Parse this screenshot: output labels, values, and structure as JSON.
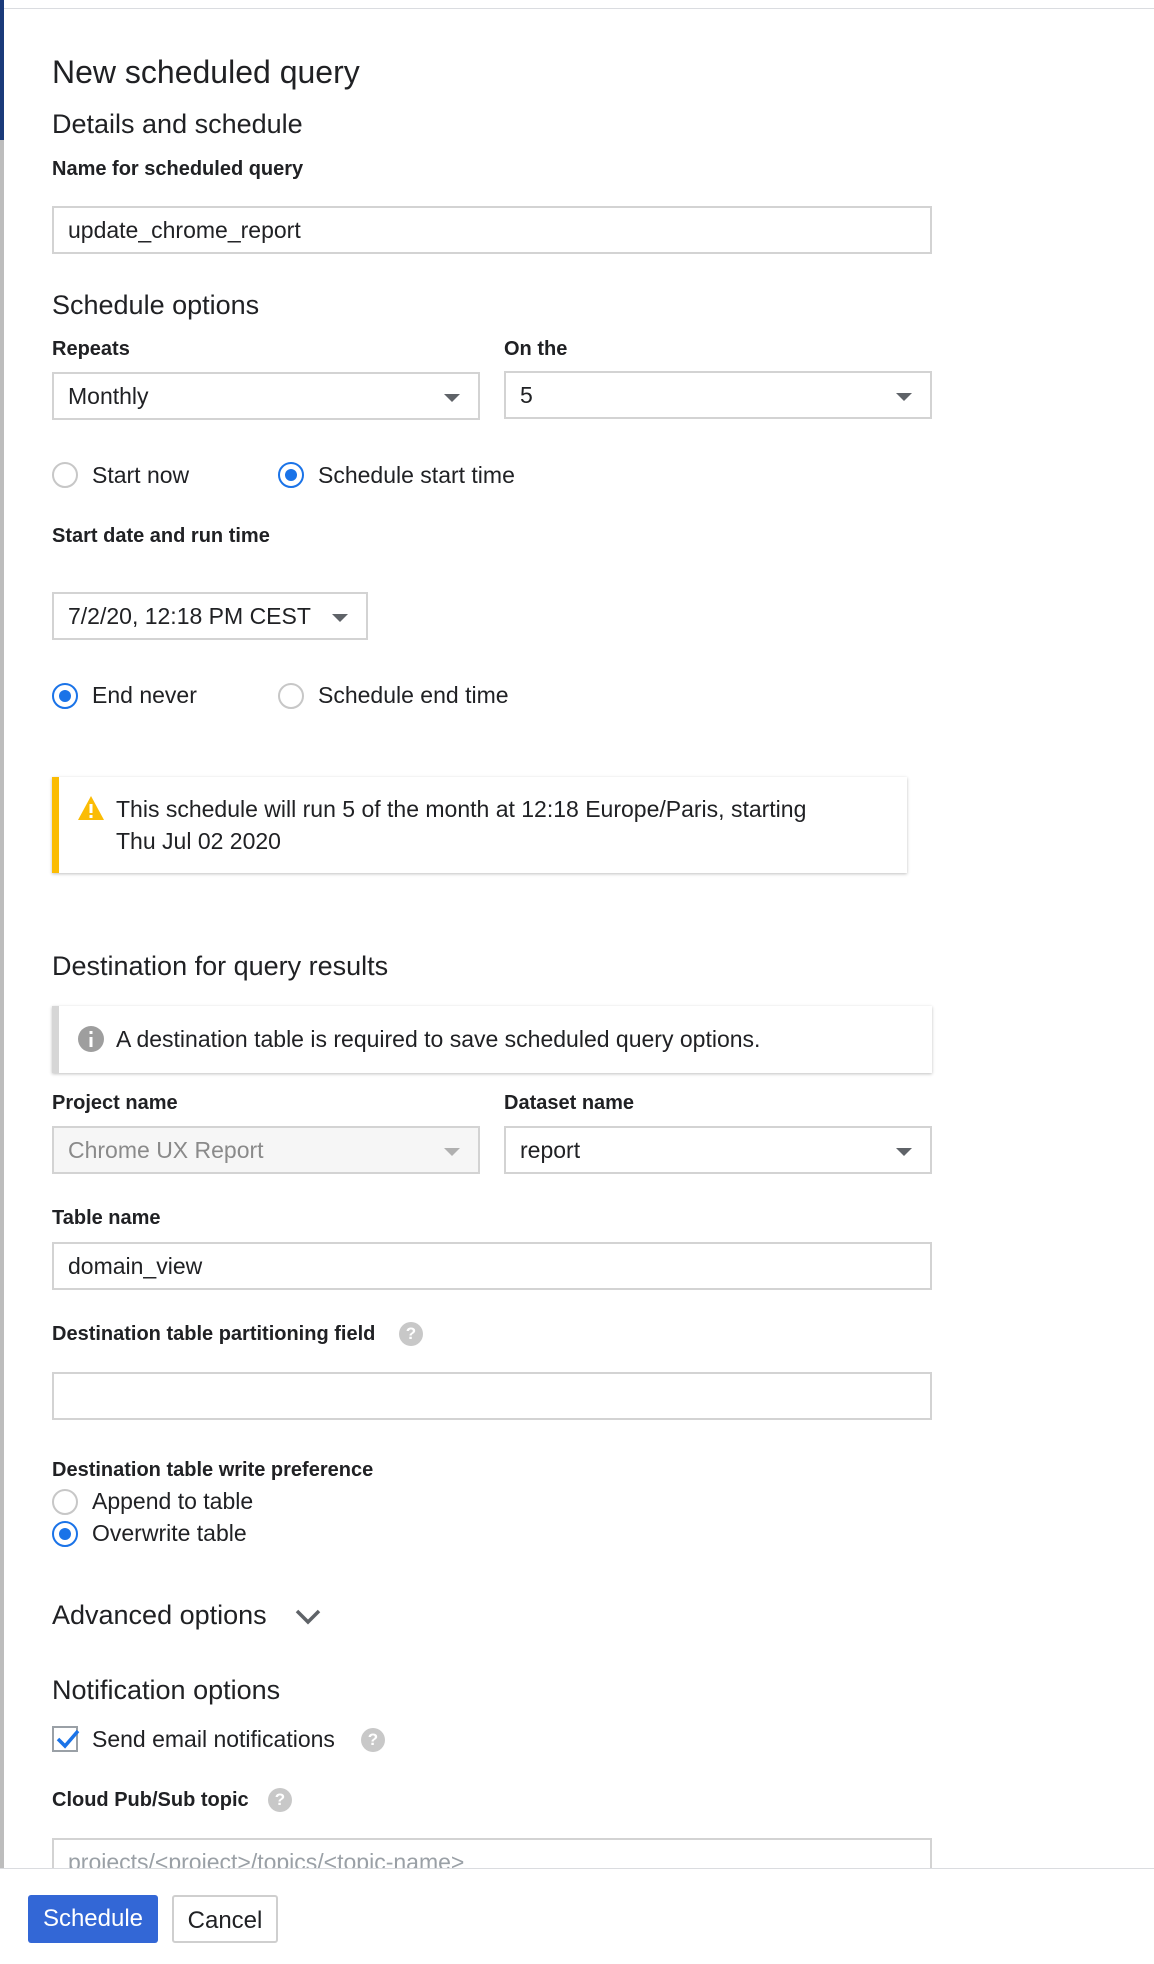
{
  "form": {
    "title": "New scheduled query",
    "details_heading": "Details and schedule",
    "name_label": "Name for scheduled query",
    "name_value": "update_chrome_report",
    "schedule_heading": "Schedule options",
    "repeats_label": "Repeats",
    "repeats_value": "Monthly",
    "on_the_label": "On the",
    "on_the_value": "5",
    "start_now_label": "Start now",
    "schedule_start_label": "Schedule start time",
    "start_date_label": "Start date and run time",
    "start_date_value": "7/2/20, 12:18 PM CEST",
    "end_never_label": "End never",
    "schedule_end_label": "Schedule end time",
    "schedule_notice_line1": "This schedule will run 5 of the month at 12:18 Europe/Paris, starting",
    "schedule_notice_line2": "Thu Jul 02 2020"
  },
  "destination": {
    "heading": "Destination for query results",
    "info_notice": "A destination table is required to save scheduled query options.",
    "project_label": "Project name",
    "project_value": "Chrome UX Report",
    "dataset_label": "Dataset name",
    "dataset_value": "report",
    "table_label": "Table name",
    "table_value": "domain_view",
    "partition_label": "Destination table partitioning field",
    "partition_value": "",
    "write_pref_label": "Destination table write preference",
    "append_label": "Append to table",
    "overwrite_label": "Overwrite table"
  },
  "advanced": {
    "label": "Advanced options"
  },
  "notifications": {
    "heading": "Notification options",
    "email_label": "Send email notifications",
    "pubsub_label": "Cloud Pub/Sub topic",
    "pubsub_placeholder": "projects/<project>/topics/<topic-name>"
  },
  "footer": {
    "schedule_button": "Schedule",
    "cancel_button": "Cancel"
  },
  "colors": {
    "accent": "#1a73e8",
    "primary_button": "#3367d6",
    "warning": "#fbbc04",
    "info": "#9e9e9e"
  },
  "icons": {
    "warning": "warning-icon",
    "info": "info-icon",
    "help": "help-icon",
    "dropdown": "caret-down-icon",
    "expand": "chevron-down-icon",
    "check": "checkmark-icon"
  }
}
